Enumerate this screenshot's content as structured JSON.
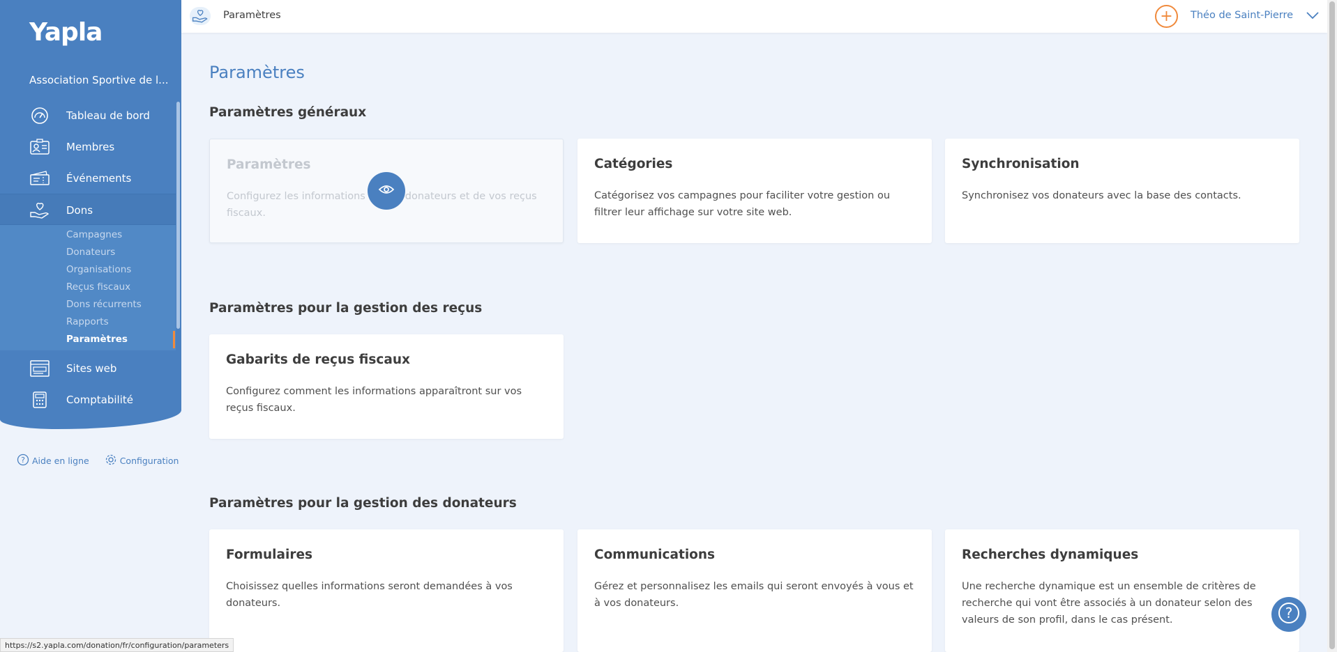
{
  "sidebar": {
    "logo": "Yapla",
    "org_name": "Association Sportive de l...",
    "nav": [
      {
        "label": "Tableau de bord",
        "icon": "dashboard-gauge-icon"
      },
      {
        "label": "Membres",
        "icon": "members-card-icon"
      },
      {
        "label": "Événements",
        "icon": "events-ticket-icon"
      },
      {
        "label": "Dons",
        "icon": "donation-hand-heart-icon"
      },
      {
        "label": "Sites web",
        "icon": "website-browser-icon"
      },
      {
        "label": "Comptabilité",
        "icon": "accounting-calculator-icon"
      }
    ],
    "dons_sub": [
      {
        "label": "Campagnes"
      },
      {
        "label": "Donateurs"
      },
      {
        "label": "Organisations"
      },
      {
        "label": "Reçus fiscaux"
      },
      {
        "label": "Dons récurrents"
      },
      {
        "label": "Rapports"
      },
      {
        "label": "Paramètres"
      }
    ],
    "footer": {
      "help": "Aide en ligne",
      "config": "Configuration"
    }
  },
  "topbar": {
    "title": "Paramètres",
    "user": "Théo de Saint-Pierre"
  },
  "main": {
    "page_title": "Paramètres",
    "sections": [
      {
        "title": "Paramètres généraux",
        "cards": [
          {
            "title": "Paramètres",
            "desc": "Configurez les informations de vos donateurs et de vos reçus fiscaux."
          },
          {
            "title": "Catégories",
            "desc": "Catégorisez vos campagnes pour faciliter votre gestion ou filtrer leur affichage sur votre site web."
          },
          {
            "title": "Synchronisation",
            "desc": "Synchronisez vos donateurs avec la base des contacts."
          }
        ]
      },
      {
        "title": "Paramètres pour la gestion des reçus",
        "cards": [
          {
            "title": "Gabarits de reçus fiscaux",
            "desc": "Configurez comment les informations apparaîtront sur vos reçus fiscaux."
          }
        ]
      },
      {
        "title": "Paramètres pour la gestion des donateurs",
        "cards": [
          {
            "title": "Formulaires",
            "desc": "Choisissez quelles informations seront demandées à vos donateurs."
          },
          {
            "title": "Communications",
            "desc": "Gérez et personnalisez les emails qui seront envoyés à vous et à vos donateurs."
          },
          {
            "title": "Recherches dynamiques",
            "desc": "Une recherche dynamique est un ensemble de critères de recherche qui vont être associés à un donateur selon des valeurs de son profil, dans le cas présent."
          }
        ]
      }
    ]
  },
  "status_url": "https://s2.yapla.com/donation/fr/configuration/parameters",
  "colors": {
    "brand_blue": "#4a80c0",
    "accent_orange": "#f08a3c",
    "background": "#eef3fb"
  }
}
